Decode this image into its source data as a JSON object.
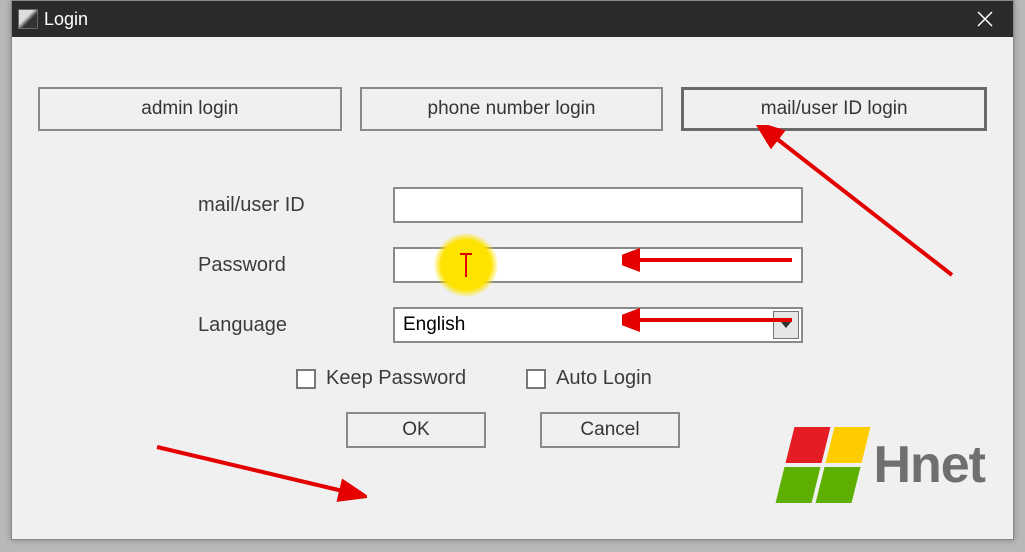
{
  "window": {
    "title": "Login"
  },
  "tabs": {
    "admin": "admin login",
    "phone": "phone number login",
    "mail": "mail/user ID login"
  },
  "form": {
    "user_label": "mail/user ID",
    "user_value": "",
    "password_label": "Password",
    "password_value": "",
    "language_label": "Language",
    "language_value": "English"
  },
  "checks": {
    "keep": "Keep Password",
    "auto": "Auto Login"
  },
  "buttons": {
    "ok": "OK",
    "cancel": "Cancel"
  },
  "logo": {
    "text": "Hnet"
  }
}
